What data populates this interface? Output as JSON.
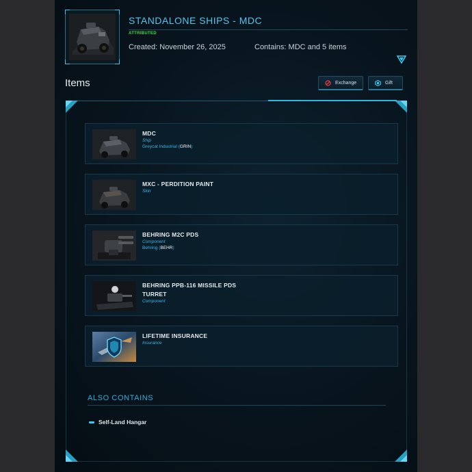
{
  "package": {
    "title": "STANDALONE SHIPS - MDC",
    "status": "ATTRIBUTED",
    "created": "Created: November 26, 2025",
    "contains": "Contains: MDC and 5 items"
  },
  "items_heading": "Items",
  "actions": {
    "exchange_label": "Exchange",
    "gift_label": "Gift"
  },
  "items": [
    {
      "name": "MDC",
      "type": "Ship",
      "maker": "Greycat Industrial",
      "maker_code": "GRIN",
      "thumb": "vehicle"
    },
    {
      "name": "MXC - PERDITION PAINT",
      "type": "Skin",
      "maker": "",
      "maker_code": "",
      "thumb": "vehicle"
    },
    {
      "name": "BEHRING M2C PDS",
      "type": "Component",
      "maker": "Behring",
      "maker_code": "BEHR",
      "thumb": "turret"
    },
    {
      "name": "BEHRING PPB-116 MISSILE PDS TURRET",
      "type": "Component",
      "maker": "",
      "maker_code": "",
      "thumb": "missile"
    },
    {
      "name": "LIFETIME INSURANCE",
      "type": "Insurance",
      "maker": "",
      "maker_code": "",
      "thumb": "insurance"
    }
  ],
  "also_contains": {
    "heading": "ALSO CONTAINS",
    "items": [
      "Self-Land Hangar"
    ]
  },
  "colors": {
    "accent": "#2fb8df",
    "status_green": "#35e04d",
    "panel_bg": "#08141d"
  }
}
